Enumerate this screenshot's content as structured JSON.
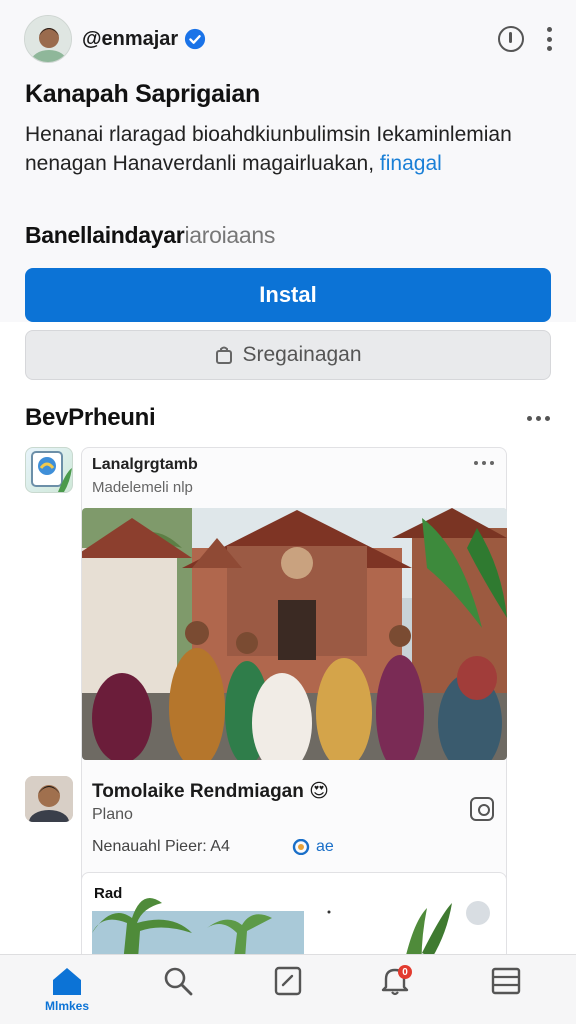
{
  "header": {
    "handle": "@enmajar"
  },
  "app": {
    "title": "Kanapah Saprigaian",
    "description": "Henanai rlaragad bioahdkiunbulimsin Iekaminlemian nenagan Hanaverdanli magairluakan,",
    "description_link": "finagal",
    "subtitle_bold": "Banellaindayar",
    "subtitle_light": "iaroiaans"
  },
  "actions": {
    "install": "Instal",
    "secondary": "Sregainagan"
  },
  "section": {
    "title": "BevPrheuni"
  },
  "card": {
    "title": "Lanalgrgtamb",
    "subtitle": "Madelemeli nlp"
  },
  "comment": {
    "name": "Tomolaike Rendmiagan",
    "emoji": "😍",
    "plan": "Plano",
    "meta": "Nenauahl Pieer: A4",
    "tag": "ae"
  },
  "card2": {
    "title": "Rad"
  },
  "nav": {
    "items": [
      {
        "name": "home",
        "label": "Mlmkes"
      },
      {
        "name": "search",
        "label": ""
      },
      {
        "name": "edit",
        "label": ""
      },
      {
        "name": "notifications",
        "label": "",
        "badge": "0"
      },
      {
        "name": "menu",
        "label": ""
      }
    ]
  },
  "colors": {
    "accent": "#0c73d6",
    "badge": "#e23b2f",
    "link": "#1a7fd6"
  }
}
